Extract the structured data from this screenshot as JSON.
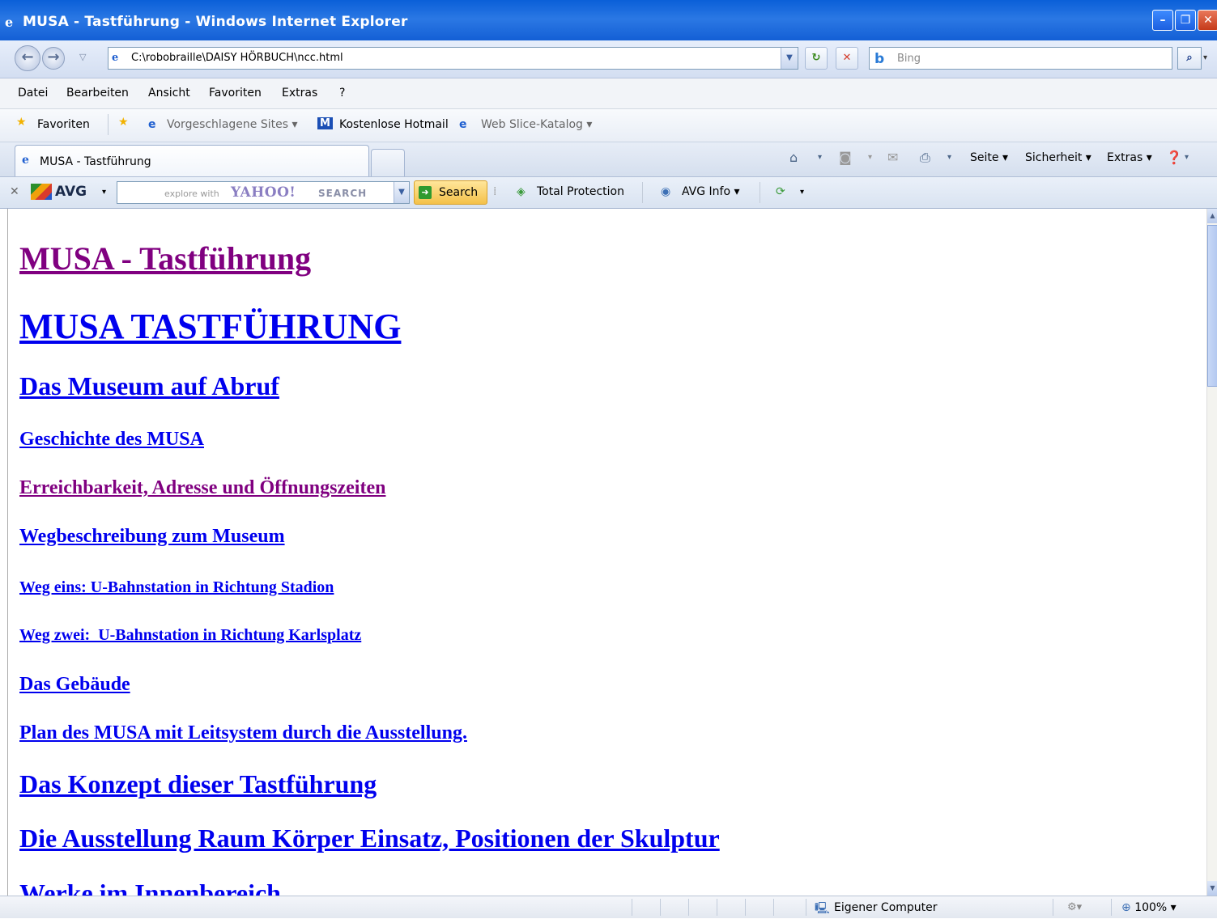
{
  "window": {
    "title": "MUSA - Tastführung - Windows Internet Explorer",
    "min_glyph": "–",
    "max_glyph": "❐",
    "close_glyph": "✕"
  },
  "address": {
    "url": "C:\\robobraille\\DAISY HÖRBUCH\\ncc.html",
    "search_placeholder": "Bing"
  },
  "menu": [
    "Datei",
    "Bearbeiten",
    "Ansicht",
    "Favoriten",
    "Extras",
    "?"
  ],
  "favorites": {
    "label": "Favoriten",
    "items": [
      "Vorgeschlagene Sites ▾",
      "Kostenlose Hotmail",
      "Web Slice-Katalog ▾"
    ]
  },
  "tab": {
    "label": "MUSA - Tastführung"
  },
  "commands": {
    "seite": "Seite ▾",
    "sicherheit": "Sicherheit ▾",
    "extras": "Extras ▾"
  },
  "avg": {
    "brand": "AVG",
    "search_placeholder": "explore with",
    "yahoo_logo": "YAHOO!",
    "yahoo_search": "SEARCH",
    "search_button": "Search",
    "total_protection": "Total Protection",
    "avg_info": "AVG Info ▾"
  },
  "content": {
    "links": [
      {
        "text": "MUSA - Tastführung",
        "visited": true
      },
      {
        "text": "MUSA TASTFÜHRUNG",
        "visited": false
      },
      {
        "text": "Das Museum auf Abruf",
        "visited": false
      },
      {
        "text": "Geschichte des MUSA",
        "visited": false
      },
      {
        "text": "Erreichbarkeit, Adresse und Öffnungszeiten",
        "visited": true
      },
      {
        "text": "Wegbeschreibung zum Museum",
        "visited": false
      },
      {
        "text": "Weg eins: U-Bahnstation in Richtung Stadion",
        "visited": false
      },
      {
        "text": "Weg zwei:  U-Bahnstation in Richtung Karlsplatz",
        "visited": false
      },
      {
        "text": "Das Gebäude",
        "visited": false
      },
      {
        "text": "Plan des MUSA mit Leitsystem durch die Ausstellung.",
        "visited": false
      },
      {
        "text": "Das Konzept dieser Tastführung",
        "visited": false
      },
      {
        "text": "Die Ausstellung Raum Körper Einsatz, Positionen der Skulptur",
        "visited": false
      },
      {
        "text": "Werke im Innenbereich",
        "visited": false
      }
    ]
  },
  "status": {
    "zone": "Eigener Computer",
    "zoom": "100%"
  },
  "colors": {
    "link": "#0000ee",
    "visited": "#800080"
  }
}
